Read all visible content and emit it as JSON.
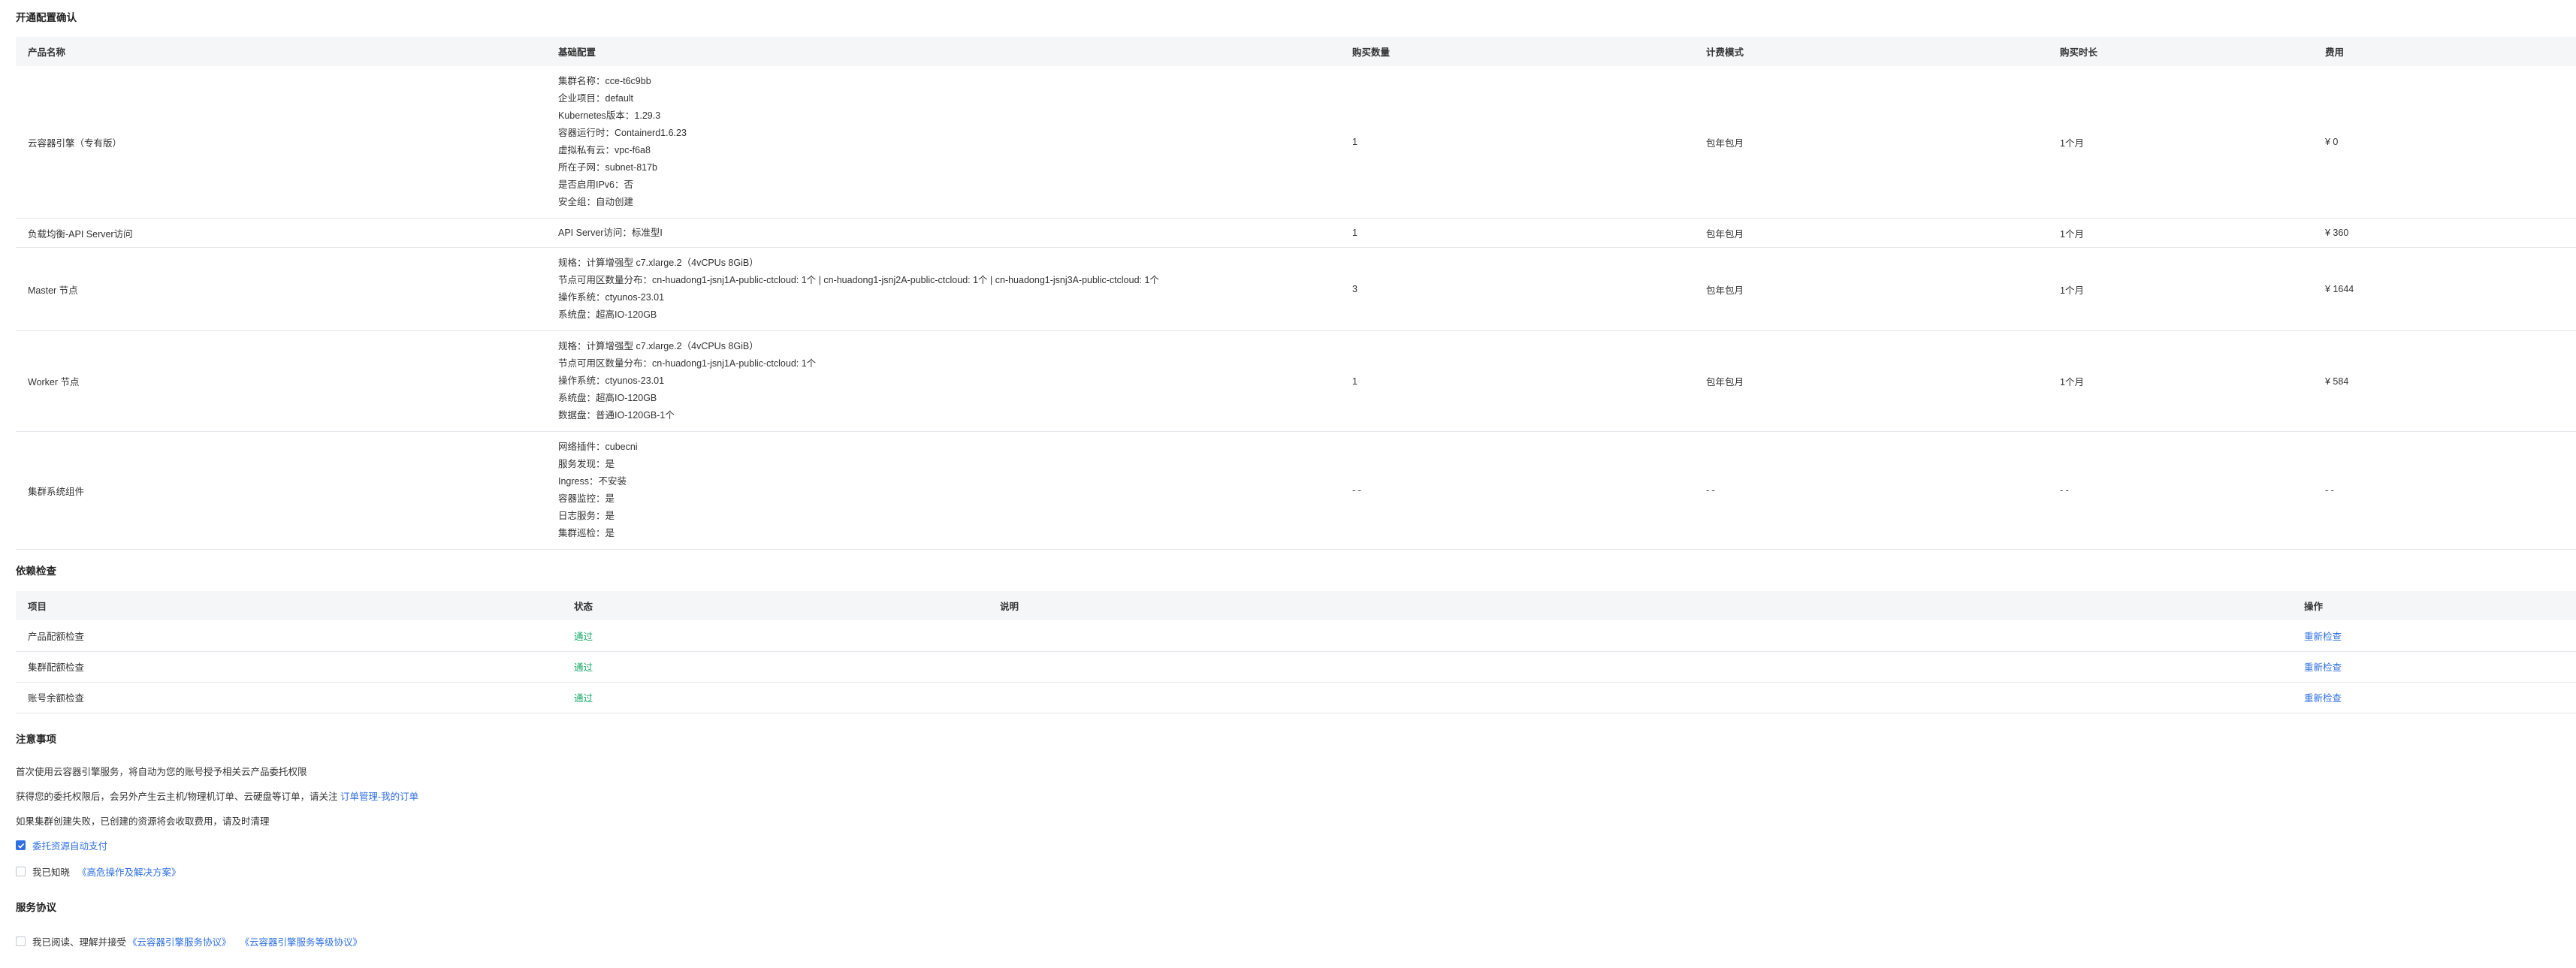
{
  "section_config": {
    "title": "开通配置确认",
    "headers": [
      "产品名称",
      "基础配置",
      "购买数量",
      "计费模式",
      "购买时长",
      "费用"
    ],
    "rows": [
      {
        "name": "云容器引擎（专有版）",
        "config": [
          "集群名称：cce-t6c9bb",
          "企业项目：default",
          "Kubernetes版本：1.29.3",
          "容器运行时：Containerd1.6.23",
          "虚拟私有云：vpc-f6a8",
          "所在子网：subnet-817b",
          "是否启用IPv6：否",
          "安全组：自动创建"
        ],
        "qty": "1",
        "billing": "包年包月",
        "duration": "1个月",
        "price": "¥ 0"
      },
      {
        "name": "负载均衡-API Server访问",
        "config": [
          "API Server访问：标准型I"
        ],
        "qty": "1",
        "billing": "包年包月",
        "duration": "1个月",
        "price": "¥ 360"
      },
      {
        "name": "Master 节点",
        "config": [
          "规格：计算增强型 c7.xlarge.2（4vCPUs 8GiB）",
          "节点可用区数量分布：cn-huadong1-jsnj1A-public-ctcloud: 1个 | cn-huadong1-jsnj2A-public-ctcloud: 1个 | cn-huadong1-jsnj3A-public-ctcloud: 1个",
          "操作系统：ctyunos-23.01",
          "系统盘：超高IO-120GB"
        ],
        "qty": "3",
        "billing": "包年包月",
        "duration": "1个月",
        "price": "¥ 1644"
      },
      {
        "name": "Worker 节点",
        "config": [
          "规格：计算增强型 c7.xlarge.2（4vCPUs 8GiB）",
          "节点可用区数量分布：cn-huadong1-jsnj1A-public-ctcloud: 1个",
          "操作系统：ctyunos-23.01",
          "系统盘：超高IO-120GB",
          "数据盘：普通IO-120GB-1个"
        ],
        "qty": "1",
        "billing": "包年包月",
        "duration": "1个月",
        "price": "¥ 584"
      },
      {
        "name": "集群系统组件",
        "config": [
          "网络插件：cubecni",
          "服务发现：是",
          "Ingress：不安装",
          "容器监控：是",
          "日志服务：是",
          "集群巡检：是"
        ],
        "qty": "- -",
        "billing": "- -",
        "duration": "- -",
        "price": "- -"
      }
    ]
  },
  "section_deps": {
    "title": "依赖检查",
    "headers": [
      "项目",
      "状态",
      "说明",
      "操作"
    ],
    "rows": [
      {
        "item": "产品配额检查",
        "status": "通过",
        "desc": "",
        "action": "重新检查"
      },
      {
        "item": "集群配额检查",
        "status": "通过",
        "desc": "",
        "action": "重新检查"
      },
      {
        "item": "账号余额检查",
        "status": "通过",
        "desc": "",
        "action": "重新检查"
      }
    ]
  },
  "section_notice": {
    "title": "注意事项",
    "line1": "首次使用云容器引擎服务，将自动为您的账号授予相关云产品委托权限",
    "line2_prefix": "获得您的委托权限后，会另外产生云主机/物理机订单、云硬盘等订单，请关注",
    "line2_link": "订单管理-我的订单",
    "line3": "如果集群创建失败，已创建的资源将会收取费用，请及时清理",
    "checkbox1_label": "委托资源自动支付",
    "checkbox2_prefix": "我已知晓",
    "checkbox2_link": "《高危操作及解决方案》"
  },
  "section_agreement": {
    "title": "服务协议",
    "prefix": "我已阅读、理解并接受",
    "link1": "《云容器引擎服务协议》",
    "link2": "《云容器引擎服务等级协议》"
  },
  "colors": {
    "accent": "#2f6fe0",
    "pass": "#13a865",
    "header_bg": "#f5f6f8"
  }
}
